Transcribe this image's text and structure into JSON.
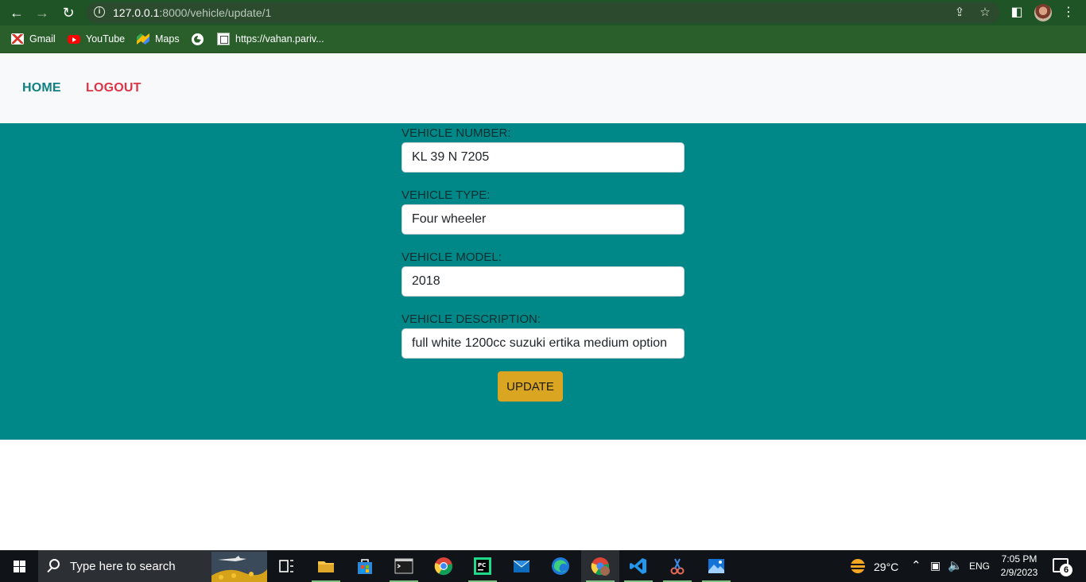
{
  "browser": {
    "url_host": "127.0.0.1",
    "url_path": ":8000/vehicle/update/1",
    "bookmarks": [
      {
        "label": "Gmail",
        "icon": "gmail-icon"
      },
      {
        "label": "YouTube",
        "icon": "youtube-icon"
      },
      {
        "label": "Maps",
        "icon": "maps-icon"
      },
      {
        "label": "",
        "icon": "globe-icon"
      },
      {
        "label": "https://vahan.pariv...",
        "icon": "vahan-site-icon"
      }
    ]
  },
  "navbar": {
    "home_label": "HOME",
    "logout_label": "LOGOUT",
    "home_color": "#0f7f82",
    "logout_color": "#dc3545"
  },
  "form": {
    "background": "#008787",
    "fields": [
      {
        "label": "VEHICLE NUMBER:",
        "value": "KL 39 N 7205"
      },
      {
        "label": "VEHICLE TYPE:",
        "value": "Four wheeler"
      },
      {
        "label": "VEHICLE MODEL:",
        "value": "2018"
      },
      {
        "label": "VEHICLE DESCRIPTION:",
        "value": "full white 1200cc suzuki ertika medium option"
      }
    ],
    "submit_label": "UPDATE",
    "submit_color": "#daa520"
  },
  "taskbar": {
    "search_placeholder": "Type here to search",
    "weather": "29°C",
    "language": "ENG",
    "time": "7:05 PM",
    "date": "2/9/2023",
    "notification_count": "6"
  }
}
